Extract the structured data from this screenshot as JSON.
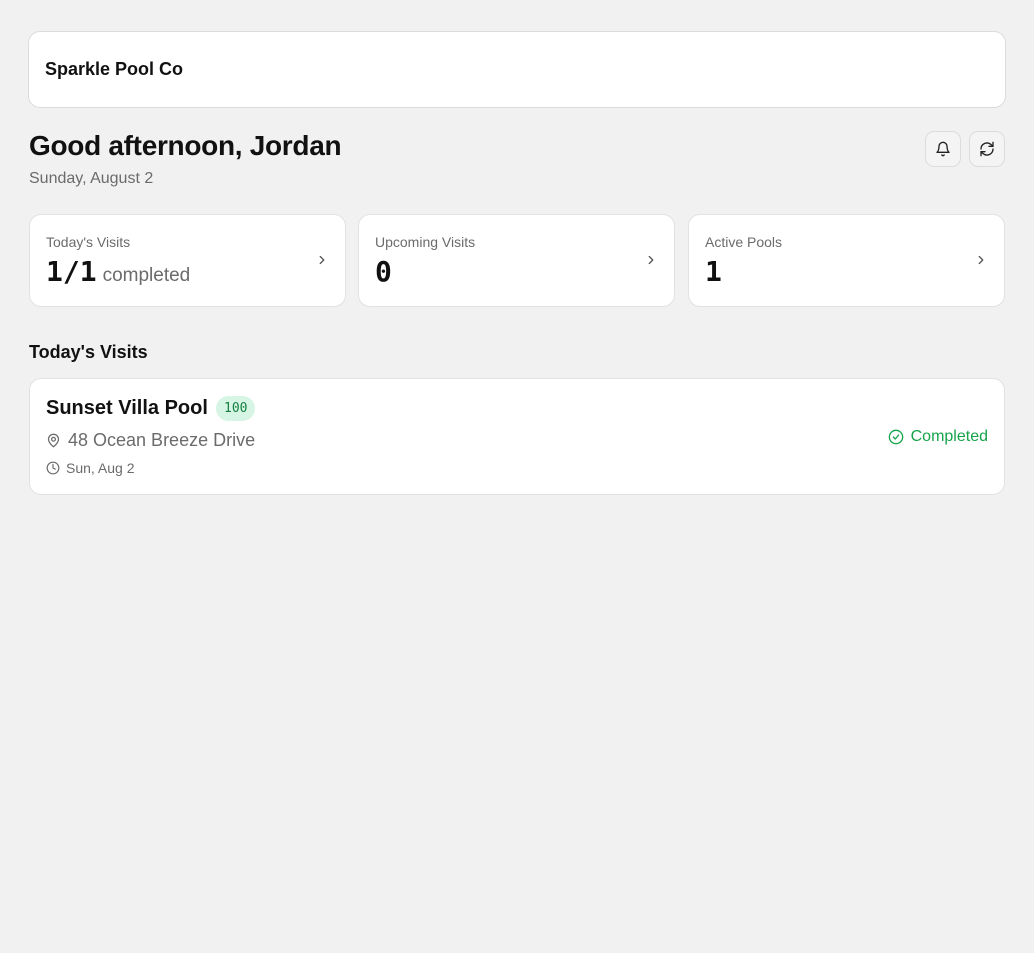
{
  "header": {
    "brand": "Sparkle Pool Co"
  },
  "greeting": {
    "title": "Good afternoon, Jordan",
    "date": "Sunday, August 2",
    "actions": [
      {
        "icon": "bell-icon"
      },
      {
        "icon": "refresh-icon"
      }
    ]
  },
  "stats": [
    {
      "label": "Today's Visits",
      "value": "1/1",
      "suffix": "completed"
    },
    {
      "label": "Upcoming Visits",
      "value": "0",
      "suffix": ""
    },
    {
      "label": "Active Pools",
      "value": "1",
      "suffix": ""
    }
  ],
  "visits": {
    "section_title": "Today's Visits",
    "items": [
      {
        "name": "Sunset Villa Pool",
        "badge": "100",
        "address": "48 Ocean Breeze Drive",
        "date": "Sun, Aug 2",
        "status": "Completed"
      }
    ]
  },
  "colors": {
    "background": "#f1f1f1",
    "card": "#ffffff",
    "success": "#16a34a",
    "badge_bg": "#d6f5e4",
    "muted_text": "#6b6b6b"
  }
}
